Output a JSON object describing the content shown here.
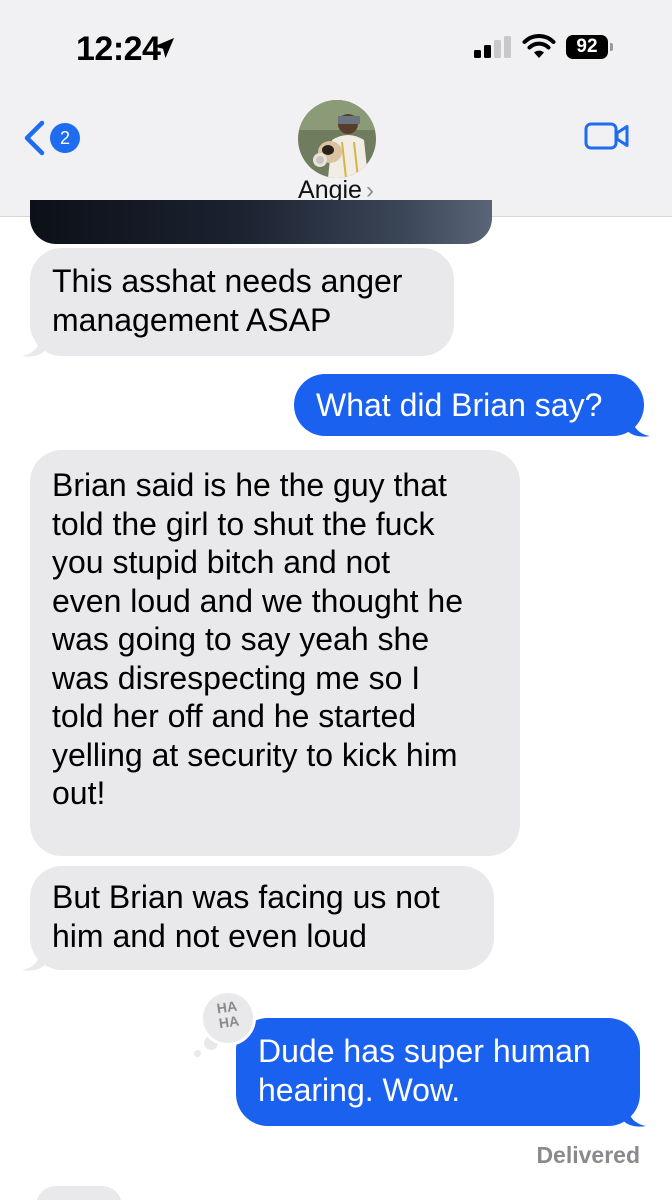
{
  "status_bar": {
    "time": "12:24",
    "battery_level": "92"
  },
  "header": {
    "back_badge_count": "2",
    "contact_name": "Angie",
    "contact_chevron": "›"
  },
  "messages": [
    {
      "direction": "incoming",
      "text": "This asshat needs anger\nmanagement ASAP"
    },
    {
      "direction": "outgoing",
      "text": "What did Brian say?"
    },
    {
      "direction": "incoming",
      "text": "Brian said is he the guy that\ntold the girl to shut the fuck\nyou stupid bitch and not\neven loud and we thought he\nwas going to say yeah she\nwas disrespecting me so I\ntold her off and he started\nyelling at security to kick him\nout!"
    },
    {
      "direction": "incoming",
      "text": "But Brian was facing us not\nhim and not even loud"
    },
    {
      "direction": "outgoing",
      "text": "Dude has super human\nhearing. Wow.",
      "tapback": "HA\nHA"
    }
  ],
  "delivery_status": "Delivered",
  "colors": {
    "outgoing_bubble": "#1a61f0",
    "incoming_bubble": "#e9e9eb",
    "header_bg": "#f1f1f3",
    "accent": "#1e6cf0"
  },
  "icons": {
    "location": "location-arrow-icon",
    "signal": "cellular-signal-icon",
    "wifi": "wifi-icon",
    "battery": "battery-icon",
    "back": "chevron-left-icon",
    "video": "video-camera-icon"
  }
}
